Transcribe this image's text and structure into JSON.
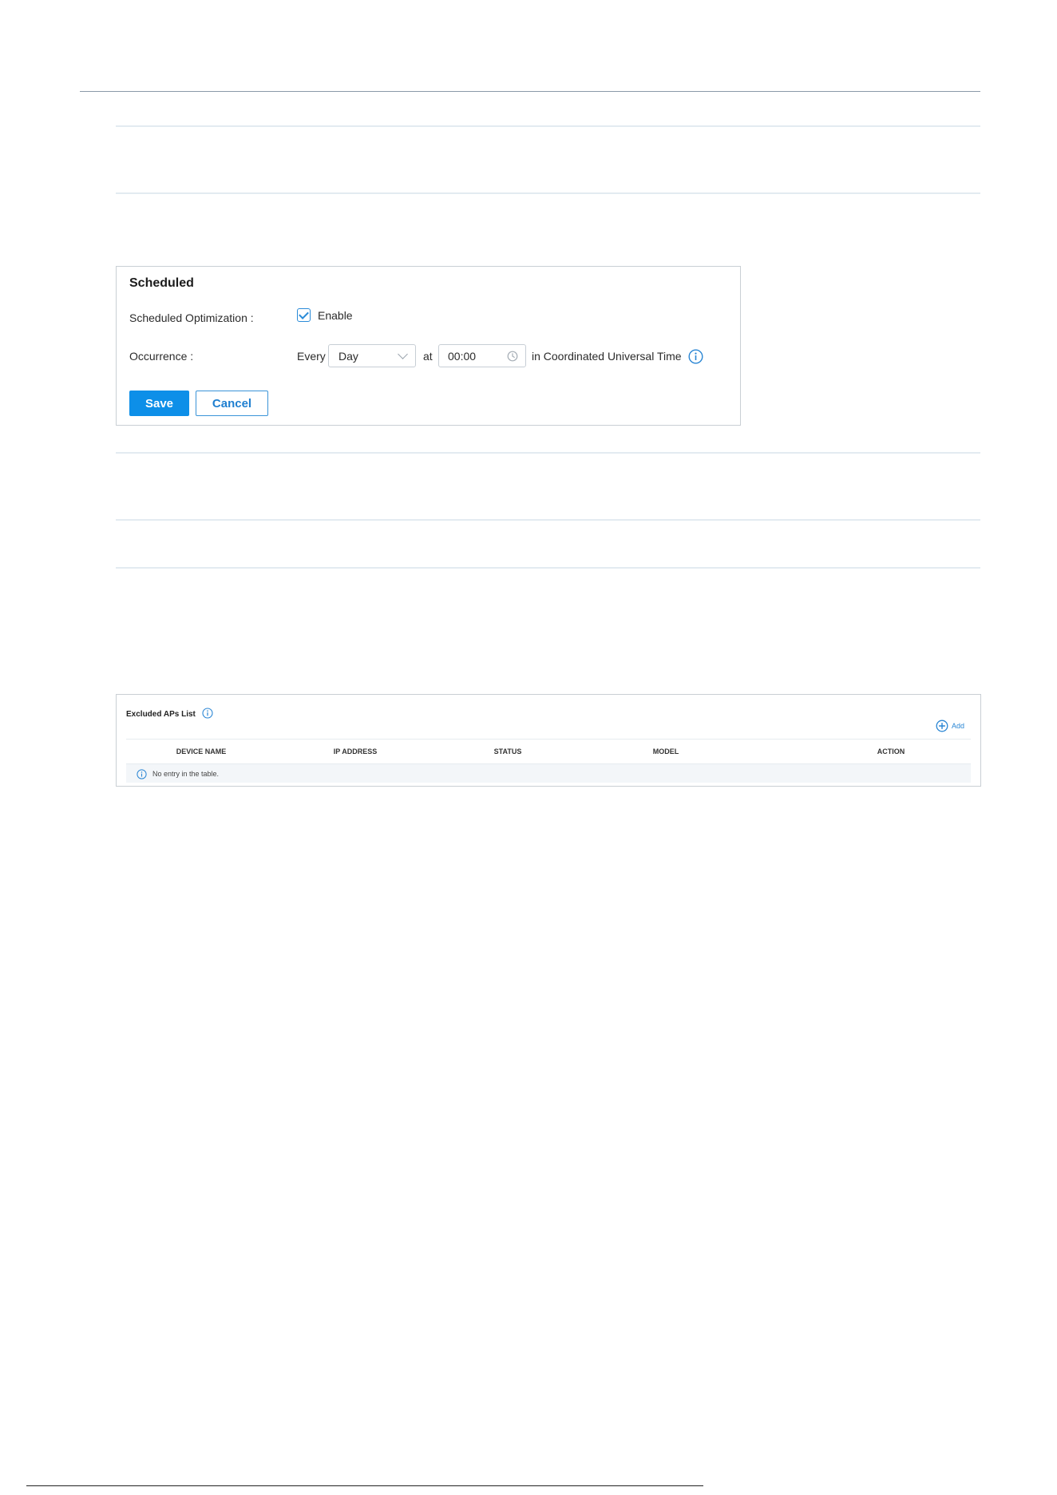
{
  "scheduled": {
    "title": "Scheduled",
    "optimization_label": "Scheduled Optimization :",
    "enable_label": "Enable",
    "enable_checked": true,
    "occurrence_label": "Occurrence :",
    "every_text": "Every",
    "frequency_value": "Day",
    "at_text": "at",
    "time_value": "00:00",
    "timezone_text": "in Coordinated Universal Time",
    "save_label": "Save",
    "cancel_label": "Cancel"
  },
  "excluded_aps": {
    "title": "Excluded APs List",
    "add_label": "Add",
    "columns": [
      "DEVICE NAME",
      "IP ADDRESS",
      "STATUS",
      "MODEL",
      "ACTION"
    ],
    "empty_message": "No entry in the table."
  },
  "icons": {
    "info": "info-icon",
    "clock": "clock-icon",
    "add": "plus-circle-icon",
    "dropdown": "chevron-down-icon",
    "check": "check-icon"
  },
  "colors": {
    "accent": "#0d8fe8",
    "icon_blue": "#2a86d4",
    "border": "#c9cfd4"
  }
}
